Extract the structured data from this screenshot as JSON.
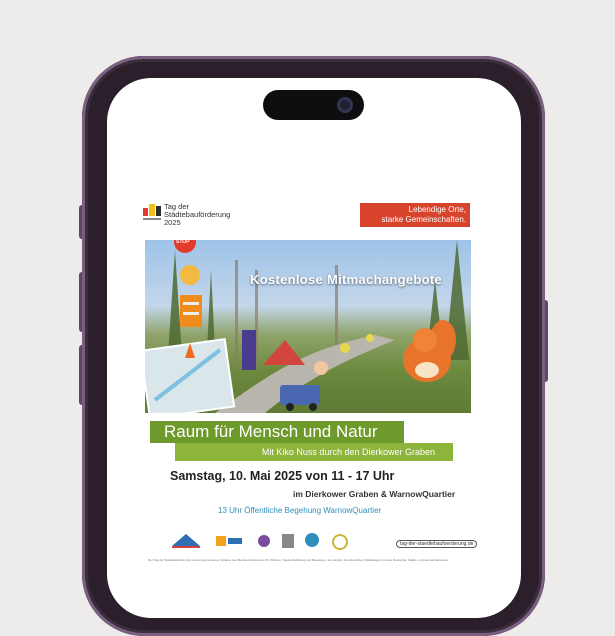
{
  "poster": {
    "logo_text": "Tag der\nStädtebauförderung\n2025",
    "slogan_line1": "Lebendige Orte,",
    "slogan_line2": "starke Gemeinschaften.",
    "hero_title": "Kostenlose Mitmachangebote",
    "stop_sign": "STOP",
    "headline": "Raum für Mensch und Natur",
    "subheadline": "Mit Kiko Nuss durch den Dierkower Graben",
    "date_line": "Samstag, 10. Mai 2025 von 11 - 17 Uhr",
    "location_line": "im Dierkower Graben & WarnowQuartier",
    "walk_line": "13 Uhr Öffentliche Begehung WarnowQuartier",
    "website": "tag-der-staedtebaufoerderung.de",
    "fine_print": "Der Tag der Städtebauförderung ist eine gemeinsame Initiative des Bundesministeriums für Wohnen, Stadtentwicklung und Bauwesen, der Länder, des Deutschen Städtetages und des Deutschen Städte- und Gemeindebundes."
  },
  "colors": {
    "background": "#eeecea",
    "phone_frame": "#2a1f2b",
    "slogan_red": "#d8432c",
    "headline_green": "#6e9a2c",
    "sub_green": "#8fb43c",
    "walk_blue": "#2f8fb8"
  }
}
